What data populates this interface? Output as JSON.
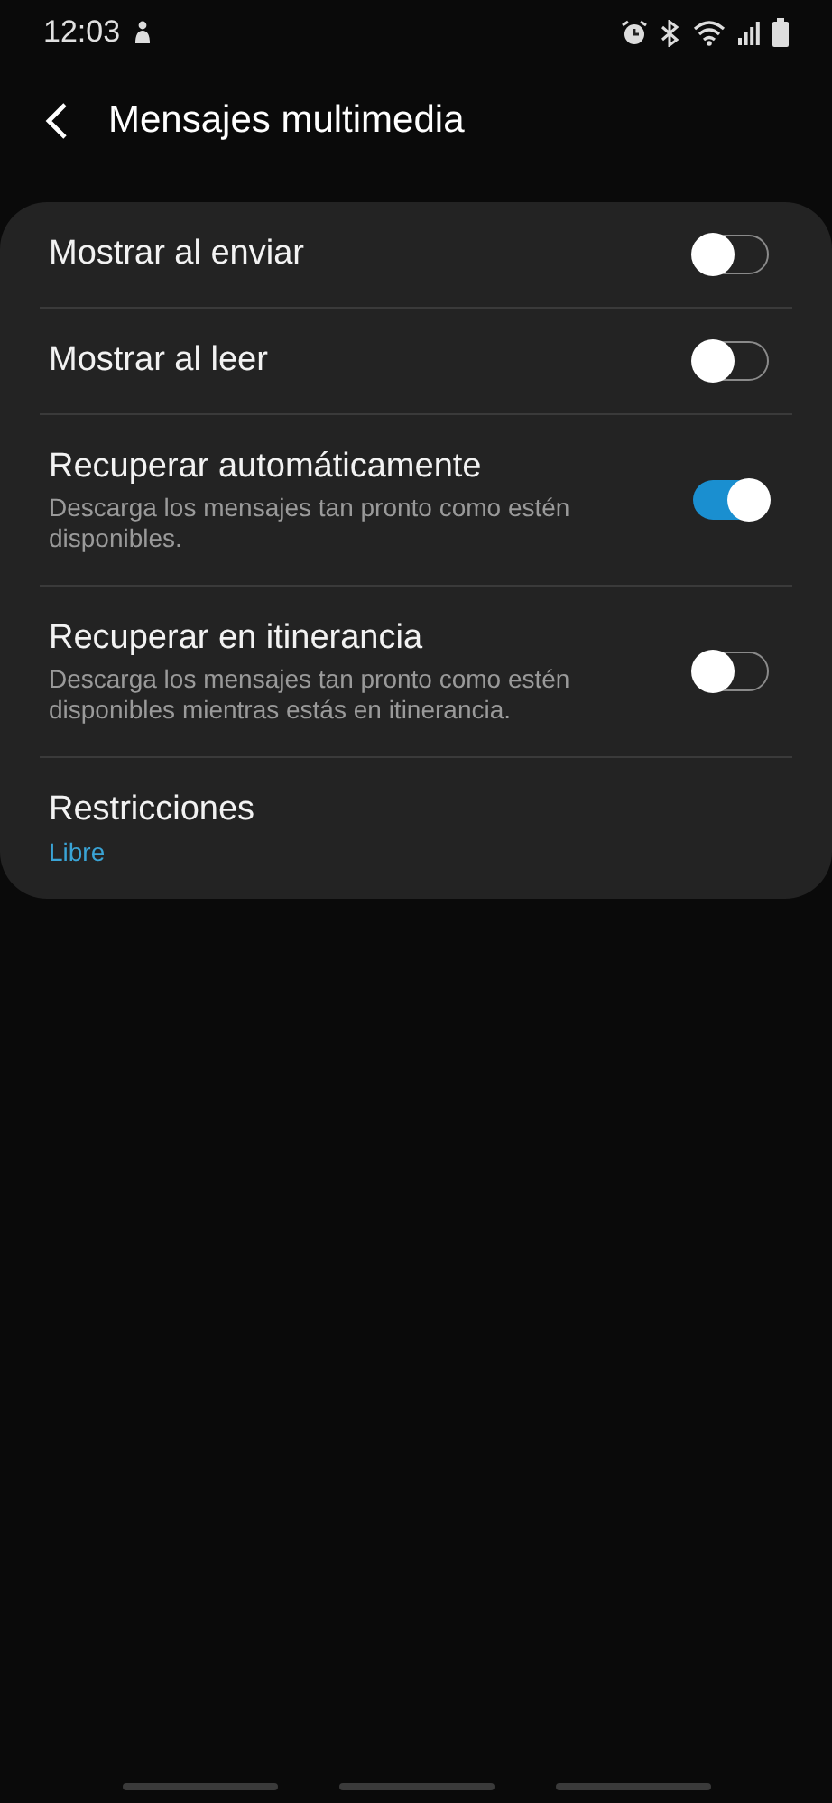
{
  "status_bar": {
    "time": "12:03"
  },
  "header": {
    "title": "Mensajes multimedia"
  },
  "settings": [
    {
      "kind": "toggle",
      "title": "Mostrar al enviar",
      "on": false
    },
    {
      "kind": "toggle",
      "title": "Mostrar al leer",
      "on": false
    },
    {
      "kind": "toggle",
      "title": "Recuperar automáticamente",
      "subtitle": "Descarga los mensajes tan pronto como estén disponibles.",
      "on": true
    },
    {
      "kind": "toggle",
      "title": "Recuperar en itinerancia",
      "subtitle": "Descarga los mensajes tan pronto como estén disponibles mientras estás en itinerancia.",
      "on": false
    },
    {
      "kind": "value",
      "title": "Restricciones",
      "value": "Libre"
    }
  ]
}
